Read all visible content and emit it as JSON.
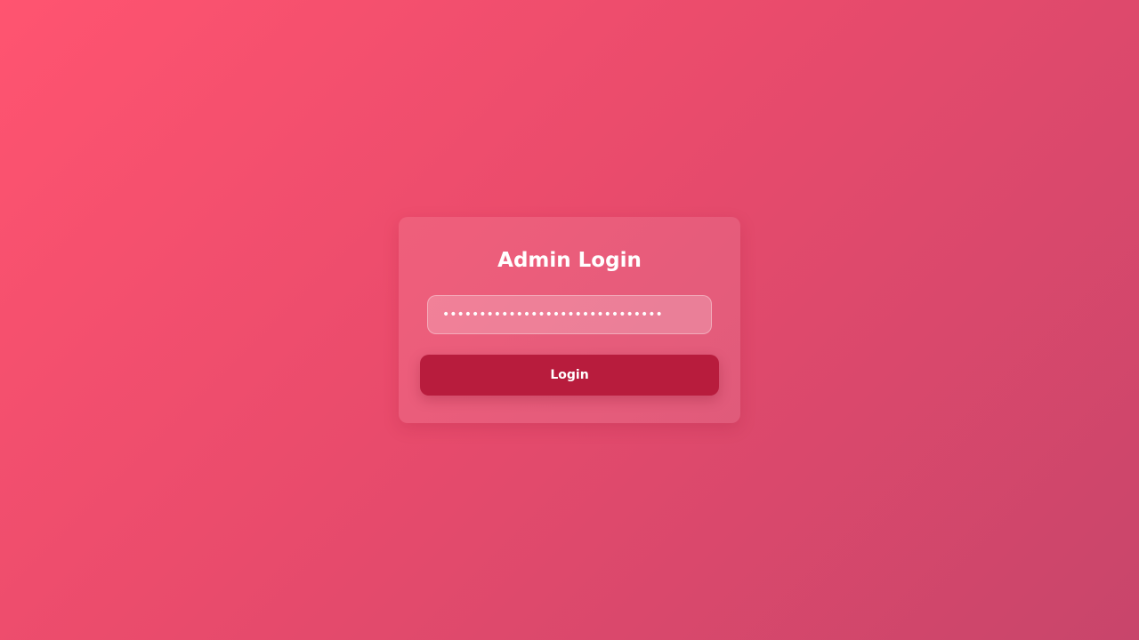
{
  "login_card": {
    "title": "Admin Login",
    "password": {
      "value": "••••••••••••••••••••••••••••••",
      "placeholder": ""
    },
    "login_button_label": "Login"
  },
  "colors": {
    "background_start": "#ff5470",
    "background_end": "#c8456b",
    "button": "#b81c3d",
    "text": "#ffffff"
  }
}
